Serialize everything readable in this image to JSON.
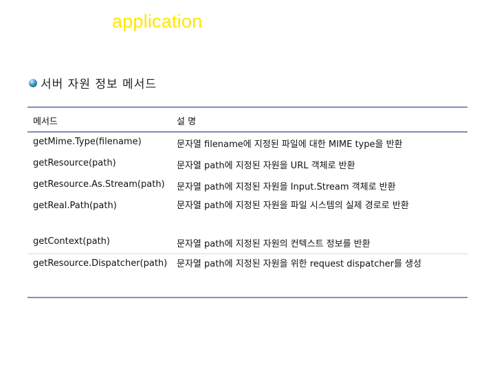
{
  "slide": {
    "title": "application",
    "bullet": "서버 자원 정보 메서드"
  },
  "table": {
    "headers": [
      "메서드",
      "설 명"
    ],
    "rows": [
      [
        "getMime.Type(filename)",
        "문자열 filename에 지정된 파일에 대한 MIME type을 반환"
      ],
      [
        "getResource(path)",
        "문자열 path에 지정된 자원을 URL 객체로 반환"
      ],
      [
        "getResource.As.Stream(path)",
        "문자열 path에 지정된 자원을 Input.Stream 객체로 반환"
      ],
      [
        "getReal.Path(path)",
        "문자열 path에 지정된 자원을 파일 시스템의 실제 경로로 반환"
      ],
      [
        "getContext(path)",
        "문자열 path에 지정된 자원의 컨텍스트 정보를 반환"
      ],
      [
        "getResource.Dispatcher(path)",
        "문자열 path에 지정된 자원을 위한 request dispatcher를 생성"
      ]
    ]
  }
}
